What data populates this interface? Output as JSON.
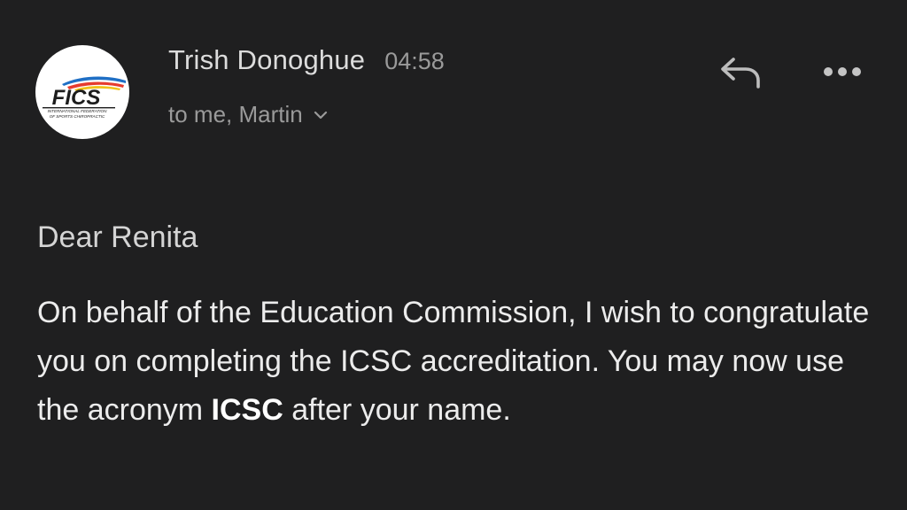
{
  "sender": {
    "name": "Trish Donoghue",
    "time": "04:58",
    "recipients": "to me, Martin",
    "avatar_logo": {
      "acronym": "FICS",
      "line1": "INTERNATIONAL FEDERATION",
      "line2": "OF SPORTS CHIROPRACTIC"
    }
  },
  "actions": {
    "reply_icon": "reply-icon",
    "more_icon": "more-horizontal-icon",
    "expand_icon": "chevron-down-icon"
  },
  "message": {
    "greeting": "Dear Renita",
    "paragraph_part1": "On behalf of the Education Commission, I wish to congratulate you on completing the ICSC accreditation. You may now use the acronym ",
    "paragraph_bold": "ICSC",
    "paragraph_part2": " after your name."
  },
  "colors": {
    "background": "#1f1f20",
    "text_primary": "#ececec",
    "text_secondary": "#9a9a9a"
  }
}
